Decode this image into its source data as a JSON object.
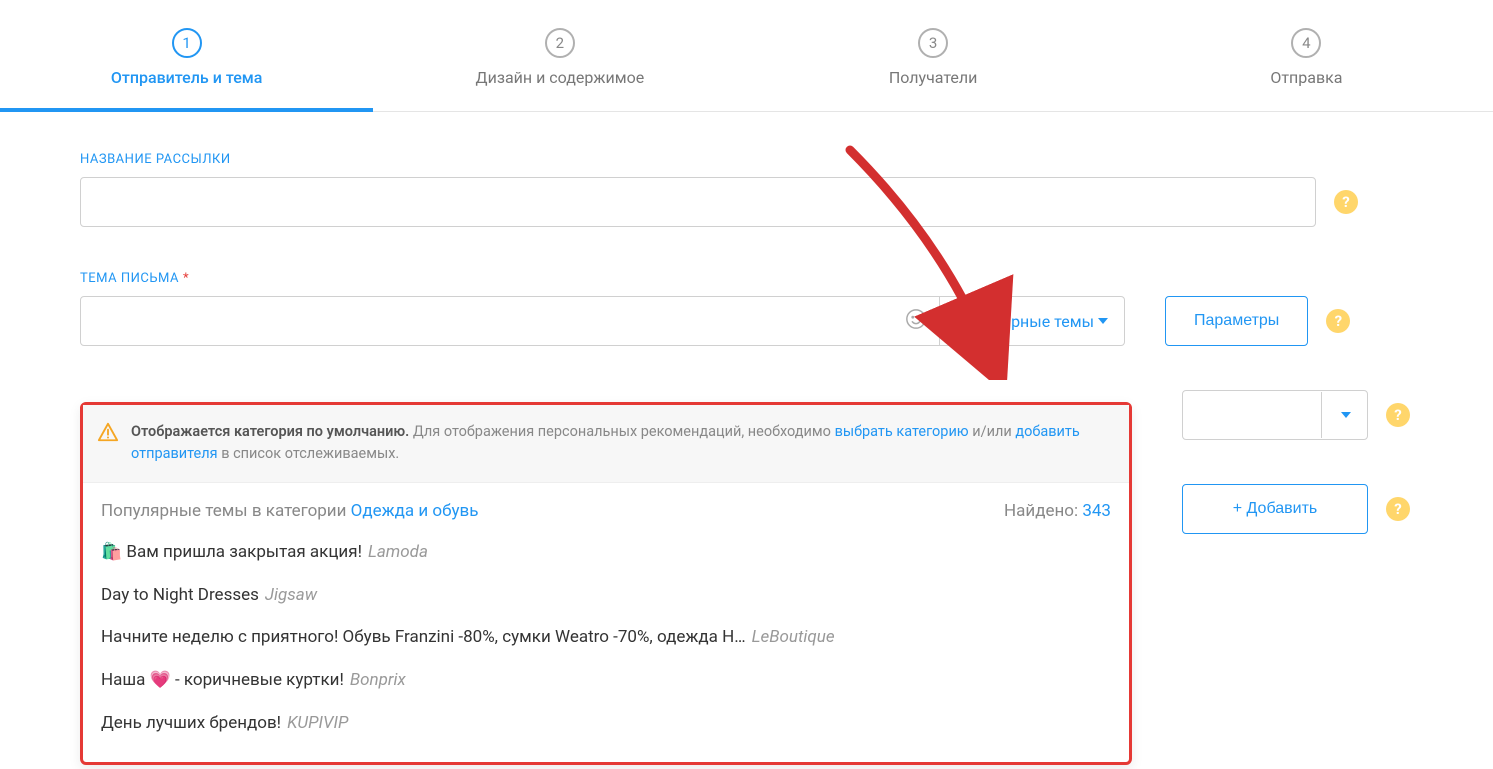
{
  "stepper": {
    "steps": [
      {
        "num": "1",
        "label": "Отправитель и тема",
        "active": true
      },
      {
        "num": "2",
        "label": "Дизайн и содержимое",
        "active": false
      },
      {
        "num": "3",
        "label": "Получатели",
        "active": false
      },
      {
        "num": "4",
        "label": "Отправка",
        "active": false
      }
    ]
  },
  "fields": {
    "name_label": "НАЗВАНИЕ РАССЫЛКИ",
    "name_value": "",
    "subject_label": "ТЕМА ПИСЬМА",
    "subject_value": "",
    "popular_dropdown_label": "Популярные темы",
    "params_button": "Параметры",
    "add_button": "+ Добавить",
    "help_badge": "?"
  },
  "popular_panel": {
    "notice_strong": "Отображается категория по умолчанию.",
    "notice_part1": " Для отображения персональных рекомендаций, необходимо ",
    "notice_link1": "выбрать категорию",
    "notice_part2": " и/или ",
    "notice_link2": "добавить отправителя",
    "notice_part3": " в список отслеживаемых.",
    "head_prefix": "Популярные темы в категории ",
    "head_category": "Одежда и обувь",
    "found_label": "Найдено: ",
    "found_count": "343",
    "suggestions": [
      {
        "text": "🛍️ Вам пришла закрытая акция!",
        "brand": "Lamoda"
      },
      {
        "text": "Day to Night Dresses",
        "brand": "Jigsaw"
      },
      {
        "text": "Начните неделю с приятного! Обувь Franzini -80%, сумки Weatro -70%, одежда Н…",
        "brand": "LeBoutique"
      },
      {
        "text": "Наша 💗 - коричневые куртки!",
        "brand": "Bonprix"
      },
      {
        "text": "День лучших брендов!",
        "brand": "KUPIVIP"
      }
    ]
  }
}
